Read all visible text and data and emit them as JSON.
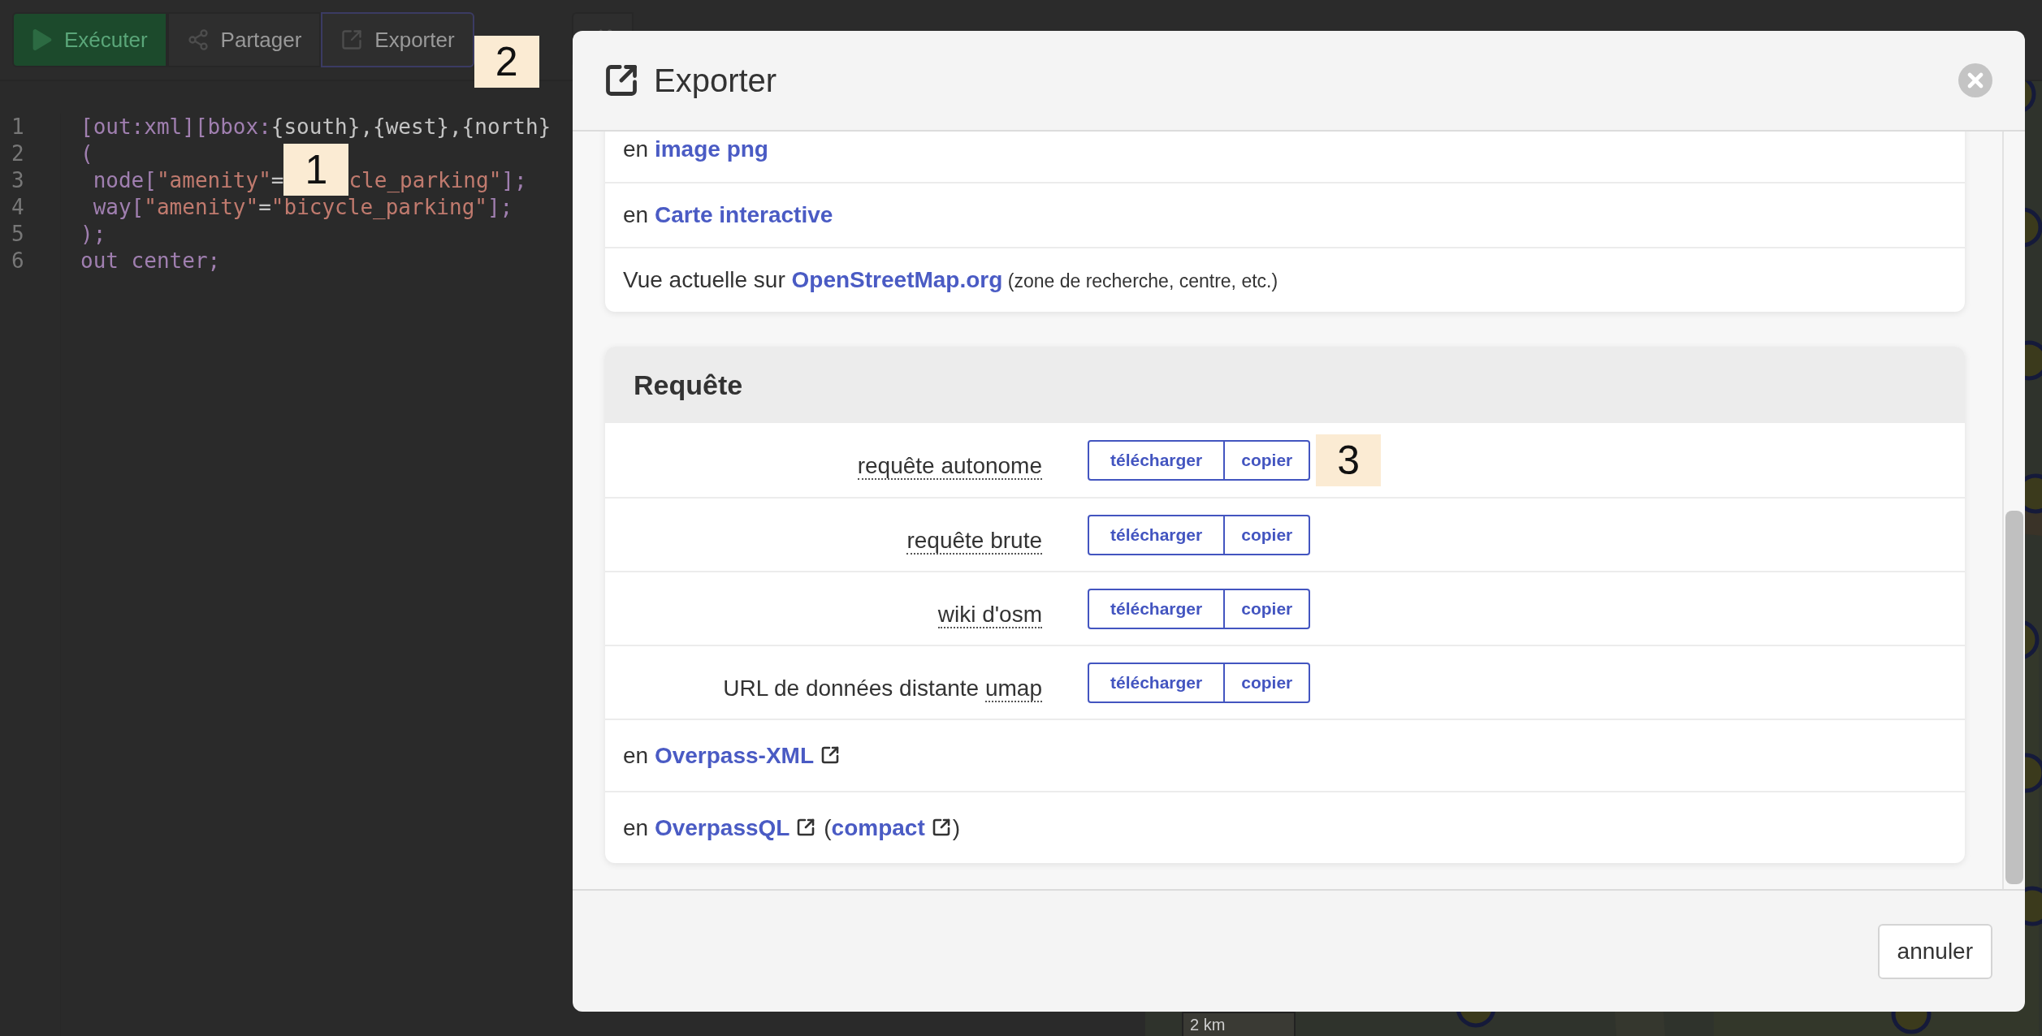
{
  "toolbar": {
    "buttons": [
      {
        "kind": "run",
        "label": "Exécuter",
        "selected": false
      },
      {
        "kind": "share",
        "label": "Partager",
        "selected": false
      },
      {
        "kind": "export",
        "label": "Exporter",
        "selected": true,
        "callout": "2"
      },
      {
        "kind": "wizard",
        "selected": false
      }
    ]
  },
  "editor": {
    "lines": [
      {
        "number": "1",
        "tokens": [
          {
            "kind": "keyword",
            "text": "[out:xml][bbox:"
          },
          {
            "kind": "plain",
            "text": "{south},{west},{north}"
          }
        ]
      },
      {
        "number": "2",
        "tokens": [
          {
            "kind": "keyword",
            "text": "("
          }
        ]
      },
      {
        "number": "3",
        "tokens": [
          {
            "kind": "keyword",
            "text": " node["
          },
          {
            "kind": "string",
            "text": "\"amenity\""
          },
          {
            "kind": "plain",
            "text": "="
          },
          {
            "kind": "callout",
            "text": "1"
          },
          {
            "kind": "string",
            "text": "cle_parking\""
          },
          {
            "kind": "keyword",
            "text": "];"
          }
        ]
      },
      {
        "number": "4",
        "tokens": [
          {
            "kind": "keyword",
            "text": " way["
          },
          {
            "kind": "string",
            "text": "\"amenity\""
          },
          {
            "kind": "plain",
            "text": "="
          },
          {
            "kind": "string",
            "text": "\"bicycle_parking\""
          },
          {
            "kind": "keyword",
            "text": "];"
          }
        ]
      },
      {
        "number": "5",
        "tokens": [
          {
            "kind": "keyword",
            "text": ");"
          }
        ]
      },
      {
        "number": "6",
        "tokens": [
          {
            "kind": "keyword",
            "text": "out center;"
          }
        ]
      }
    ]
  },
  "map": {
    "scale": "2 km"
  },
  "dialog": {
    "title": "Exporter",
    "sections": [
      {
        "rows": [
          {
            "kind": "sentence",
            "parts": [
              {
                "kind": "text",
                "text": "en "
              },
              {
                "kind": "link",
                "text": "image png"
              }
            ]
          },
          {
            "kind": "sentence",
            "parts": [
              {
                "kind": "text",
                "text": "en "
              },
              {
                "kind": "link",
                "text": "Carte interactive"
              }
            ]
          },
          {
            "kind": "sentence",
            "parts": [
              {
                "kind": "text",
                "text": "Vue actuelle sur "
              },
              {
                "kind": "link",
                "text": "OpenStreetMap.org"
              },
              {
                "kind": "note",
                "text": " (zone de recherche, centre, etc.)"
              }
            ]
          }
        ]
      },
      {
        "title": "Requête",
        "rows": [
          {
            "kind": "actions",
            "label": [
              {
                "kind": "abbr",
                "text": "requête autonome"
              }
            ],
            "buttons": [
              "télécharger",
              "copier"
            ],
            "callout": "3"
          },
          {
            "kind": "actions",
            "label": [
              {
                "kind": "abbr",
                "text": "requête brute"
              }
            ],
            "buttons": [
              "télécharger",
              "copier"
            ]
          },
          {
            "kind": "actions",
            "label": [
              {
                "kind": "abbr",
                "text": "wiki d'osm"
              }
            ],
            "buttons": [
              "télécharger",
              "copier"
            ]
          },
          {
            "kind": "actions",
            "label": [
              {
                "kind": "text",
                "text": "URL de données distante "
              },
              {
                "kind": "abbr",
                "text": "umap"
              }
            ],
            "buttons": [
              "télécharger",
              "copier"
            ]
          },
          {
            "kind": "sentence",
            "parts": [
              {
                "kind": "text",
                "text": "en "
              },
              {
                "kind": "link",
                "text": "Overpass-XML",
                "external": true
              }
            ]
          },
          {
            "kind": "sentence",
            "parts": [
              {
                "kind": "text",
                "text": "en "
              },
              {
                "kind": "link",
                "text": "OverpassQL",
                "external": true
              },
              {
                "kind": "text",
                "text": " ("
              },
              {
                "kind": "link",
                "text": "compact",
                "external": true
              },
              {
                "kind": "text",
                "text": ")"
              }
            ]
          }
        ]
      }
    ],
    "cancel": "annuler"
  }
}
